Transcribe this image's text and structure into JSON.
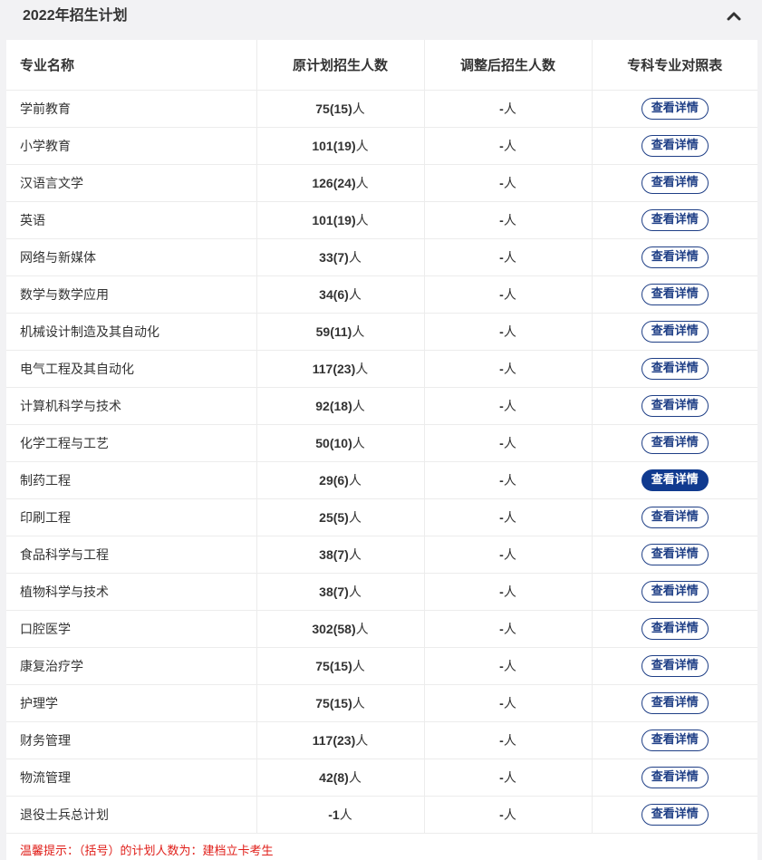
{
  "panel": {
    "title": "2022年招生计划",
    "toggle_icon": "chevron-up-icon"
  },
  "table": {
    "headers": {
      "name": "专业名称",
      "plan": "原计划招生人数",
      "adjusted": "调整后招生人数",
      "detail": "专科专业对照表"
    },
    "unit": "人",
    "button_label": "查看详情",
    "rows": [
      {
        "name": "学前教育",
        "plan": "75(15)",
        "adjusted": "-",
        "active": false
      },
      {
        "name": "小学教育",
        "plan": "101(19)",
        "adjusted": "-",
        "active": false
      },
      {
        "name": "汉语言文学",
        "plan": "126(24)",
        "adjusted": "-",
        "active": false
      },
      {
        "name": "英语",
        "plan": "101(19)",
        "adjusted": "-",
        "active": false
      },
      {
        "name": "网络与新媒体",
        "plan": "33(7)",
        "adjusted": "-",
        "active": false
      },
      {
        "name": "数学与数学应用",
        "plan": "34(6)",
        "adjusted": "-",
        "active": false
      },
      {
        "name": "机械设计制造及其自动化",
        "plan": "59(11)",
        "adjusted": "-",
        "active": false
      },
      {
        "name": "电气工程及其自动化",
        "plan": "117(23)",
        "adjusted": "-",
        "active": false
      },
      {
        "name": "计算机科学与技术",
        "plan": "92(18)",
        "adjusted": "-",
        "active": false
      },
      {
        "name": "化学工程与工艺",
        "plan": "50(10)",
        "adjusted": "-",
        "active": false
      },
      {
        "name": "制药工程",
        "plan": "29(6)",
        "adjusted": "-",
        "active": true
      },
      {
        "name": "印刷工程",
        "plan": "25(5)",
        "adjusted": "-",
        "active": false
      },
      {
        "name": "食品科学与工程",
        "plan": "38(7)",
        "adjusted": "-",
        "active": false
      },
      {
        "name": "植物科学与技术",
        "plan": "38(7)",
        "adjusted": "-",
        "active": false
      },
      {
        "name": "口腔医学",
        "plan": "302(58)",
        "adjusted": "-",
        "active": false
      },
      {
        "name": "康复治疗学",
        "plan": "75(15)",
        "adjusted": "-",
        "active": false
      },
      {
        "name": "护理学",
        "plan": "75(15)",
        "adjusted": "-",
        "active": false
      },
      {
        "name": "财务管理",
        "plan": "117(23)",
        "adjusted": "-",
        "active": false
      },
      {
        "name": "物流管理",
        "plan": "42(8)",
        "adjusted": "-",
        "active": false
      },
      {
        "name": "退役士兵总计划",
        "plan": "-1",
        "adjusted": "-",
        "active": false
      }
    ]
  },
  "tip": "温馨提示：（括号）的计划人数为：建档立卡考生",
  "colors": {
    "accent": "#1f3f86",
    "active_button": "#103a8f",
    "tip": "#e0201b",
    "background": "#f2f2f4"
  }
}
